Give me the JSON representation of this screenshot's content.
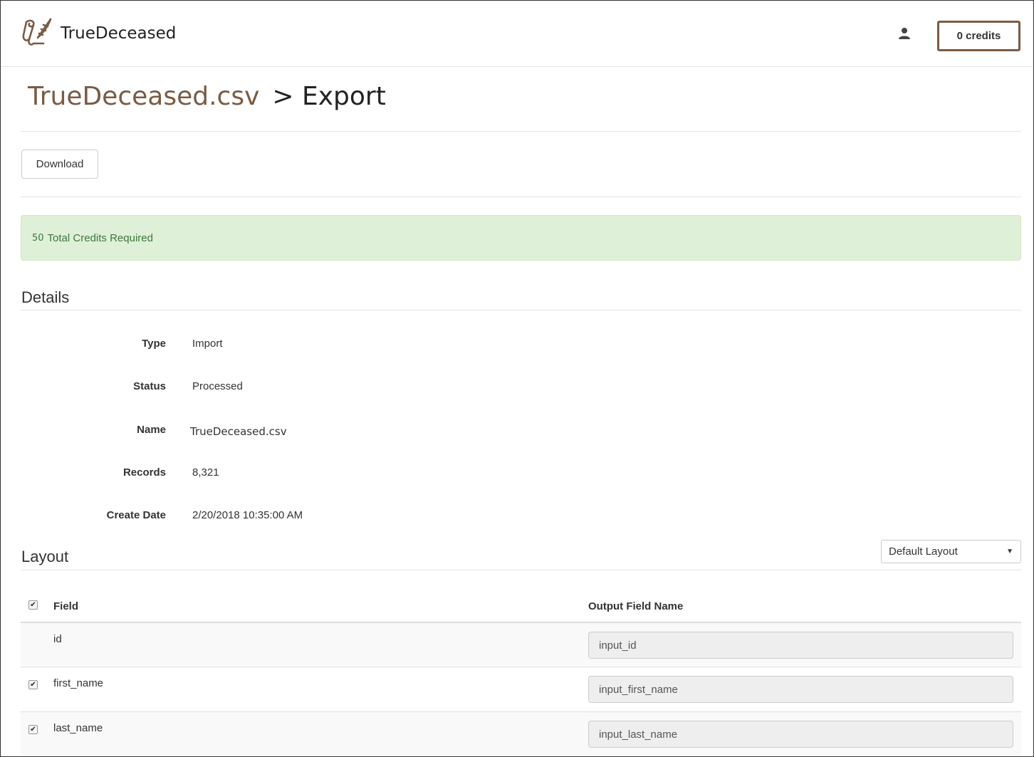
{
  "header": {
    "brand_name": "TrueDeceased",
    "credits_label": "0 credits",
    "brand_color": "#7a5b44"
  },
  "page": {
    "title_file": "TrueDeceased.csv",
    "title_section": "> Export"
  },
  "toolbar": {
    "download_label": "Download"
  },
  "alert": {
    "count": "50",
    "text": "Total Credits Required"
  },
  "details": {
    "title": "Details",
    "rows": [
      {
        "label": "Type",
        "value": "Import"
      },
      {
        "label": "Status",
        "value": "Processed"
      },
      {
        "label": "Name",
        "value": "TrueDeceased.csv"
      },
      {
        "label": "Records",
        "value": "8,321"
      },
      {
        "label": "Create Date",
        "value": "2/20/2018 10:35:00 AM"
      }
    ]
  },
  "layout": {
    "title": "Layout",
    "select_value": "Default Layout",
    "columns": {
      "field": "Field",
      "output": "Output Field Name"
    },
    "rows": [
      {
        "field": "id",
        "output": "input_id",
        "checked": false
      },
      {
        "field": "first_name",
        "output": "input_first_name",
        "checked": true
      },
      {
        "field": "last_name",
        "output": "input_last_name",
        "checked": true
      }
    ]
  }
}
